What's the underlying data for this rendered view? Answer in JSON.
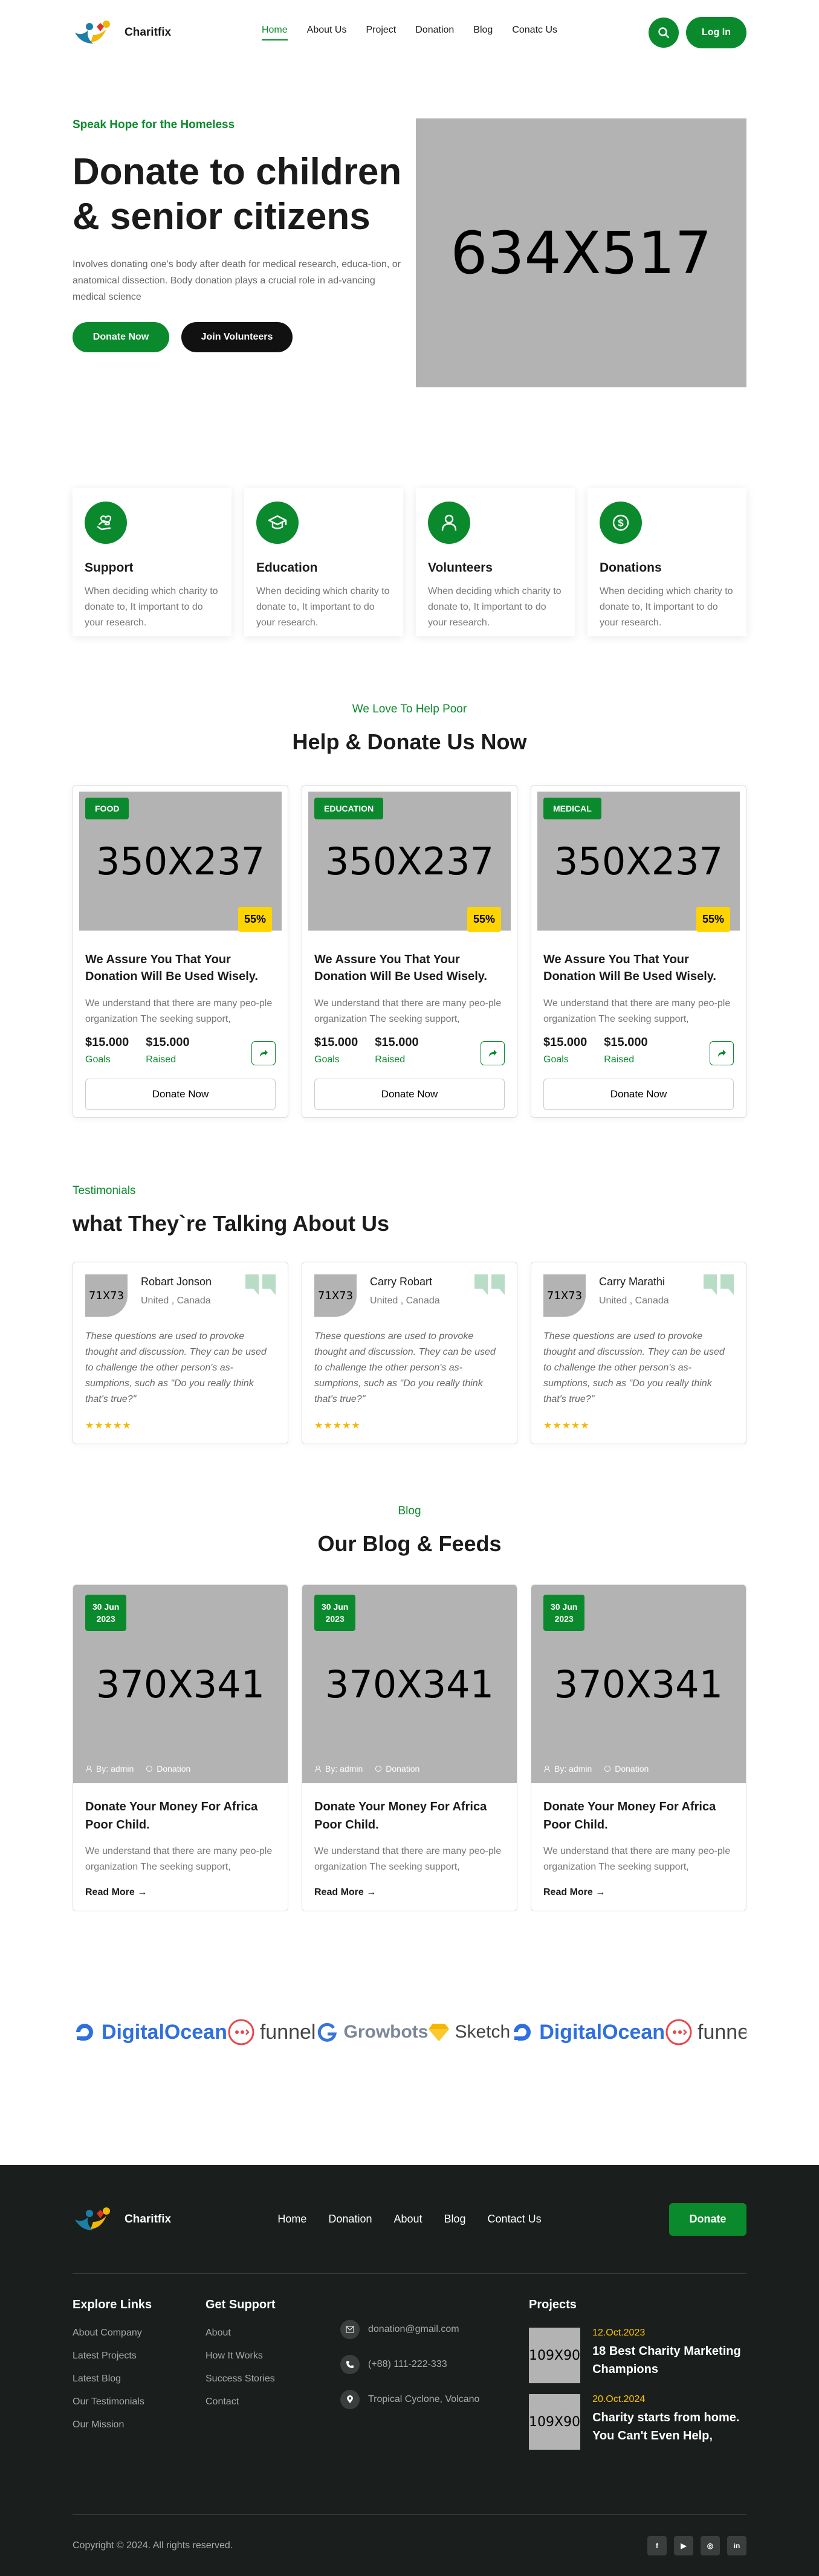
{
  "header": {
    "brand": "Charitfix",
    "nav": [
      "Home",
      "About Us",
      "Project",
      "Donation",
      "Blog",
      "Conatc Us"
    ],
    "login_label": "Log In"
  },
  "hero": {
    "eyebrow": "Speak Hope for the Homeless",
    "title": "Donate to children & senior citizens",
    "text": "Involves donating one's body after death for medical research, educa-tion, or anatomical dissection. Body donation plays a crucial role in ad-vancing medical science",
    "donate_label": "Donate Now",
    "volunteer_label": "Join Volunteers",
    "image_label": "634X517"
  },
  "features": [
    {
      "icon": "hand-heart-icon",
      "title": "Support",
      "text": "When deciding which charity to donate to, It important to do your research."
    },
    {
      "icon": "graduation-cap-icon",
      "title": "Education",
      "text": "When deciding which charity to donate to, It important to do your research."
    },
    {
      "icon": "user-icon",
      "title": "Volunteers",
      "text": "When deciding which charity to donate to, It important to do your research."
    },
    {
      "icon": "dollar-icon",
      "title": "Donations",
      "text": "When deciding which charity to donate to, It important to do your research."
    }
  ],
  "help": {
    "eyebrow": "We Love To Help Poor",
    "title": "Help & Donate Us Now",
    "cards": [
      {
        "tag": "FOOD",
        "image_label": "350X237",
        "percent": "55%",
        "title": "We Assure You That Your Donation Will Be Used Wisely.",
        "text": "We understand that there are many peo-ple organization The seeking support,",
        "goal": "$15.000",
        "goal_label": "Goals",
        "raised": "$15.000",
        "raised_label": "Raised",
        "button": "Donate Now"
      },
      {
        "tag": "EDUCATION",
        "image_label": "350X237",
        "percent": "55%",
        "title": "We Assure You That Your Donation Will Be Used Wisely.",
        "text": "We understand that there are many peo-ple organization The seeking support,",
        "goal": "$15.000",
        "goal_label": "Goals",
        "raised": "$15.000",
        "raised_label": "Raised",
        "button": "Donate Now"
      },
      {
        "tag": "MEDICAL",
        "image_label": "350X237",
        "percent": "55%",
        "title": "We Assure You That Your Donation Will Be Used Wisely.",
        "text": "We understand that there are many peo-ple organization The seeking support,",
        "goal": "$15.000",
        "goal_label": "Goals",
        "raised": "$15.000",
        "raised_label": "Raised",
        "button": "Donate Now"
      }
    ]
  },
  "testimonials": {
    "eyebrow": "Testimonials",
    "title": "what They`re Talking About Us",
    "items": [
      {
        "avatar_label": "71X73",
        "name": "Robart Jonson",
        "location": "United , Canada",
        "text": "These questions are used to provoke thought and discussion. They can be used to challenge the other person's as-sumptions, such as \"Do you really think that's true?\"",
        "stars": "★★★★★"
      },
      {
        "avatar_label": "71X73",
        "name": "Carry Robart",
        "location": "United , Canada",
        "text": "These questions are used to provoke thought and discussion. They can be used to challenge the other person's as-sumptions, such as \"Do you really think that's true?\"",
        "stars": "★★★★★"
      },
      {
        "avatar_label": "71X73",
        "name": "Carry Marathi",
        "location": "United , Canada",
        "text": "These questions are used to provoke thought and discussion. They can be used to challenge the other person's as-sumptions, such as \"Do you really think that's true?\"",
        "stars": "★★★★★"
      }
    ]
  },
  "blog": {
    "eyebrow": "Blog",
    "title": "Our Blog & Feeds",
    "posts": [
      {
        "date_day": "30 Jun",
        "date_year": "2023",
        "image_label": "370X341",
        "author": "By: admin",
        "category": "Donation",
        "title": "Donate Your Money For Africa Poor Child.",
        "text": "We understand that there are many peo-ple organization The seeking support,",
        "read_more": "Read More"
      },
      {
        "date_day": "30 Jun",
        "date_year": "2023",
        "image_label": "370X341",
        "author": "By: admin",
        "category": "Donation",
        "title": "Donate Your Money For Africa Poor Child.",
        "text": "We understand that there are many peo-ple organization The seeking support,",
        "read_more": "Read More"
      },
      {
        "date_day": "30 Jun",
        "date_year": "2023",
        "image_label": "370X341",
        "author": "By: admin",
        "category": "Donation",
        "title": "Donate Your Money For Africa Poor Child.",
        "text": "We understand that there are many peo-ple organization The seeking support,",
        "read_more": "Read More"
      }
    ]
  },
  "brands": [
    "DigitalOcean",
    "funnel",
    "Growbots",
    "Sketch",
    "DigitalOcean",
    "funnel"
  ],
  "footer": {
    "brand": "Charitfix",
    "nav": [
      "Home",
      "Donation",
      "About",
      "Blog",
      "Contact Us"
    ],
    "donate_label": "Donate",
    "explore_title": "Explore Links",
    "explore_links": [
      "About Company",
      "Latest Projects",
      "Latest Blog",
      "Our Testimonials",
      "Our Mission"
    ],
    "support_title": "Get Support",
    "support_links": [
      "About",
      "How It Works",
      "Success Stories",
      "Contact"
    ],
    "contact": {
      "email": "donation@gmail.com",
      "phone": "(+88) 111-222-333",
      "address": "Tropical Cyclone, Volcano"
    },
    "projects_title": "Projects",
    "projects": [
      {
        "image_label": "109X90",
        "date": "12.Oct.2023",
        "title": "18 Best Charity Marketing Champions"
      },
      {
        "image_label": "109X90",
        "date": "20.Oct.2024",
        "title": "Charity starts from home. You Can't Even Help,"
      }
    ],
    "copyright": "Copyright © 2024. All rights reserved.",
    "socials": [
      "f",
      "▶",
      "◎",
      "in"
    ]
  },
  "colors": {
    "accent": "#0a8a2c",
    "highlight": "#ffd400",
    "footer_bg": "#1a1e1d"
  }
}
